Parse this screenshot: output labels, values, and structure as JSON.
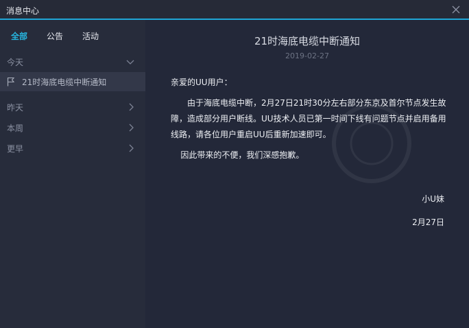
{
  "window": {
    "title": "消息中心"
  },
  "tabs": [
    {
      "label": "全部",
      "active": true
    },
    {
      "label": "公告",
      "active": false
    },
    {
      "label": "活动",
      "active": false
    }
  ],
  "sidebar": {
    "groups": [
      {
        "label": "今天",
        "expanded": true,
        "icon": "chevron-down-icon"
      },
      {
        "label": "昨天",
        "expanded": false,
        "icon": "chevron-right-icon"
      },
      {
        "label": "本周",
        "expanded": false,
        "icon": "chevron-right-icon"
      },
      {
        "label": "更早",
        "expanded": false,
        "icon": "chevron-right-icon"
      }
    ],
    "today_items": [
      {
        "label": "21时海底电缆中断通知",
        "icon": "flag-icon",
        "selected": true
      }
    ]
  },
  "message": {
    "title": "21时海底电缆中断通知",
    "date": "2019-02-27",
    "greeting": "亲爱的UU用户：",
    "paragraph1": "由于海底电缆中断，2月27日21时30分左右部分东京及首尔节点发生故障，造成部分用户断线。UU技术人员已第一时间下线有问题节点并启用备用线路，请各位用户重启UU后重新加速即可。",
    "paragraph2": "因此带来的不便，我们深感抱歉。",
    "signature": "小U妹",
    "signature_date": "2月27日"
  },
  "colors": {
    "accent": "#27b6e0",
    "titlebar_border": "#1fa6d6",
    "sidebar_bg": "#272c3b",
    "content_bg": "#232839",
    "selected_item_bg": "#333849"
  }
}
